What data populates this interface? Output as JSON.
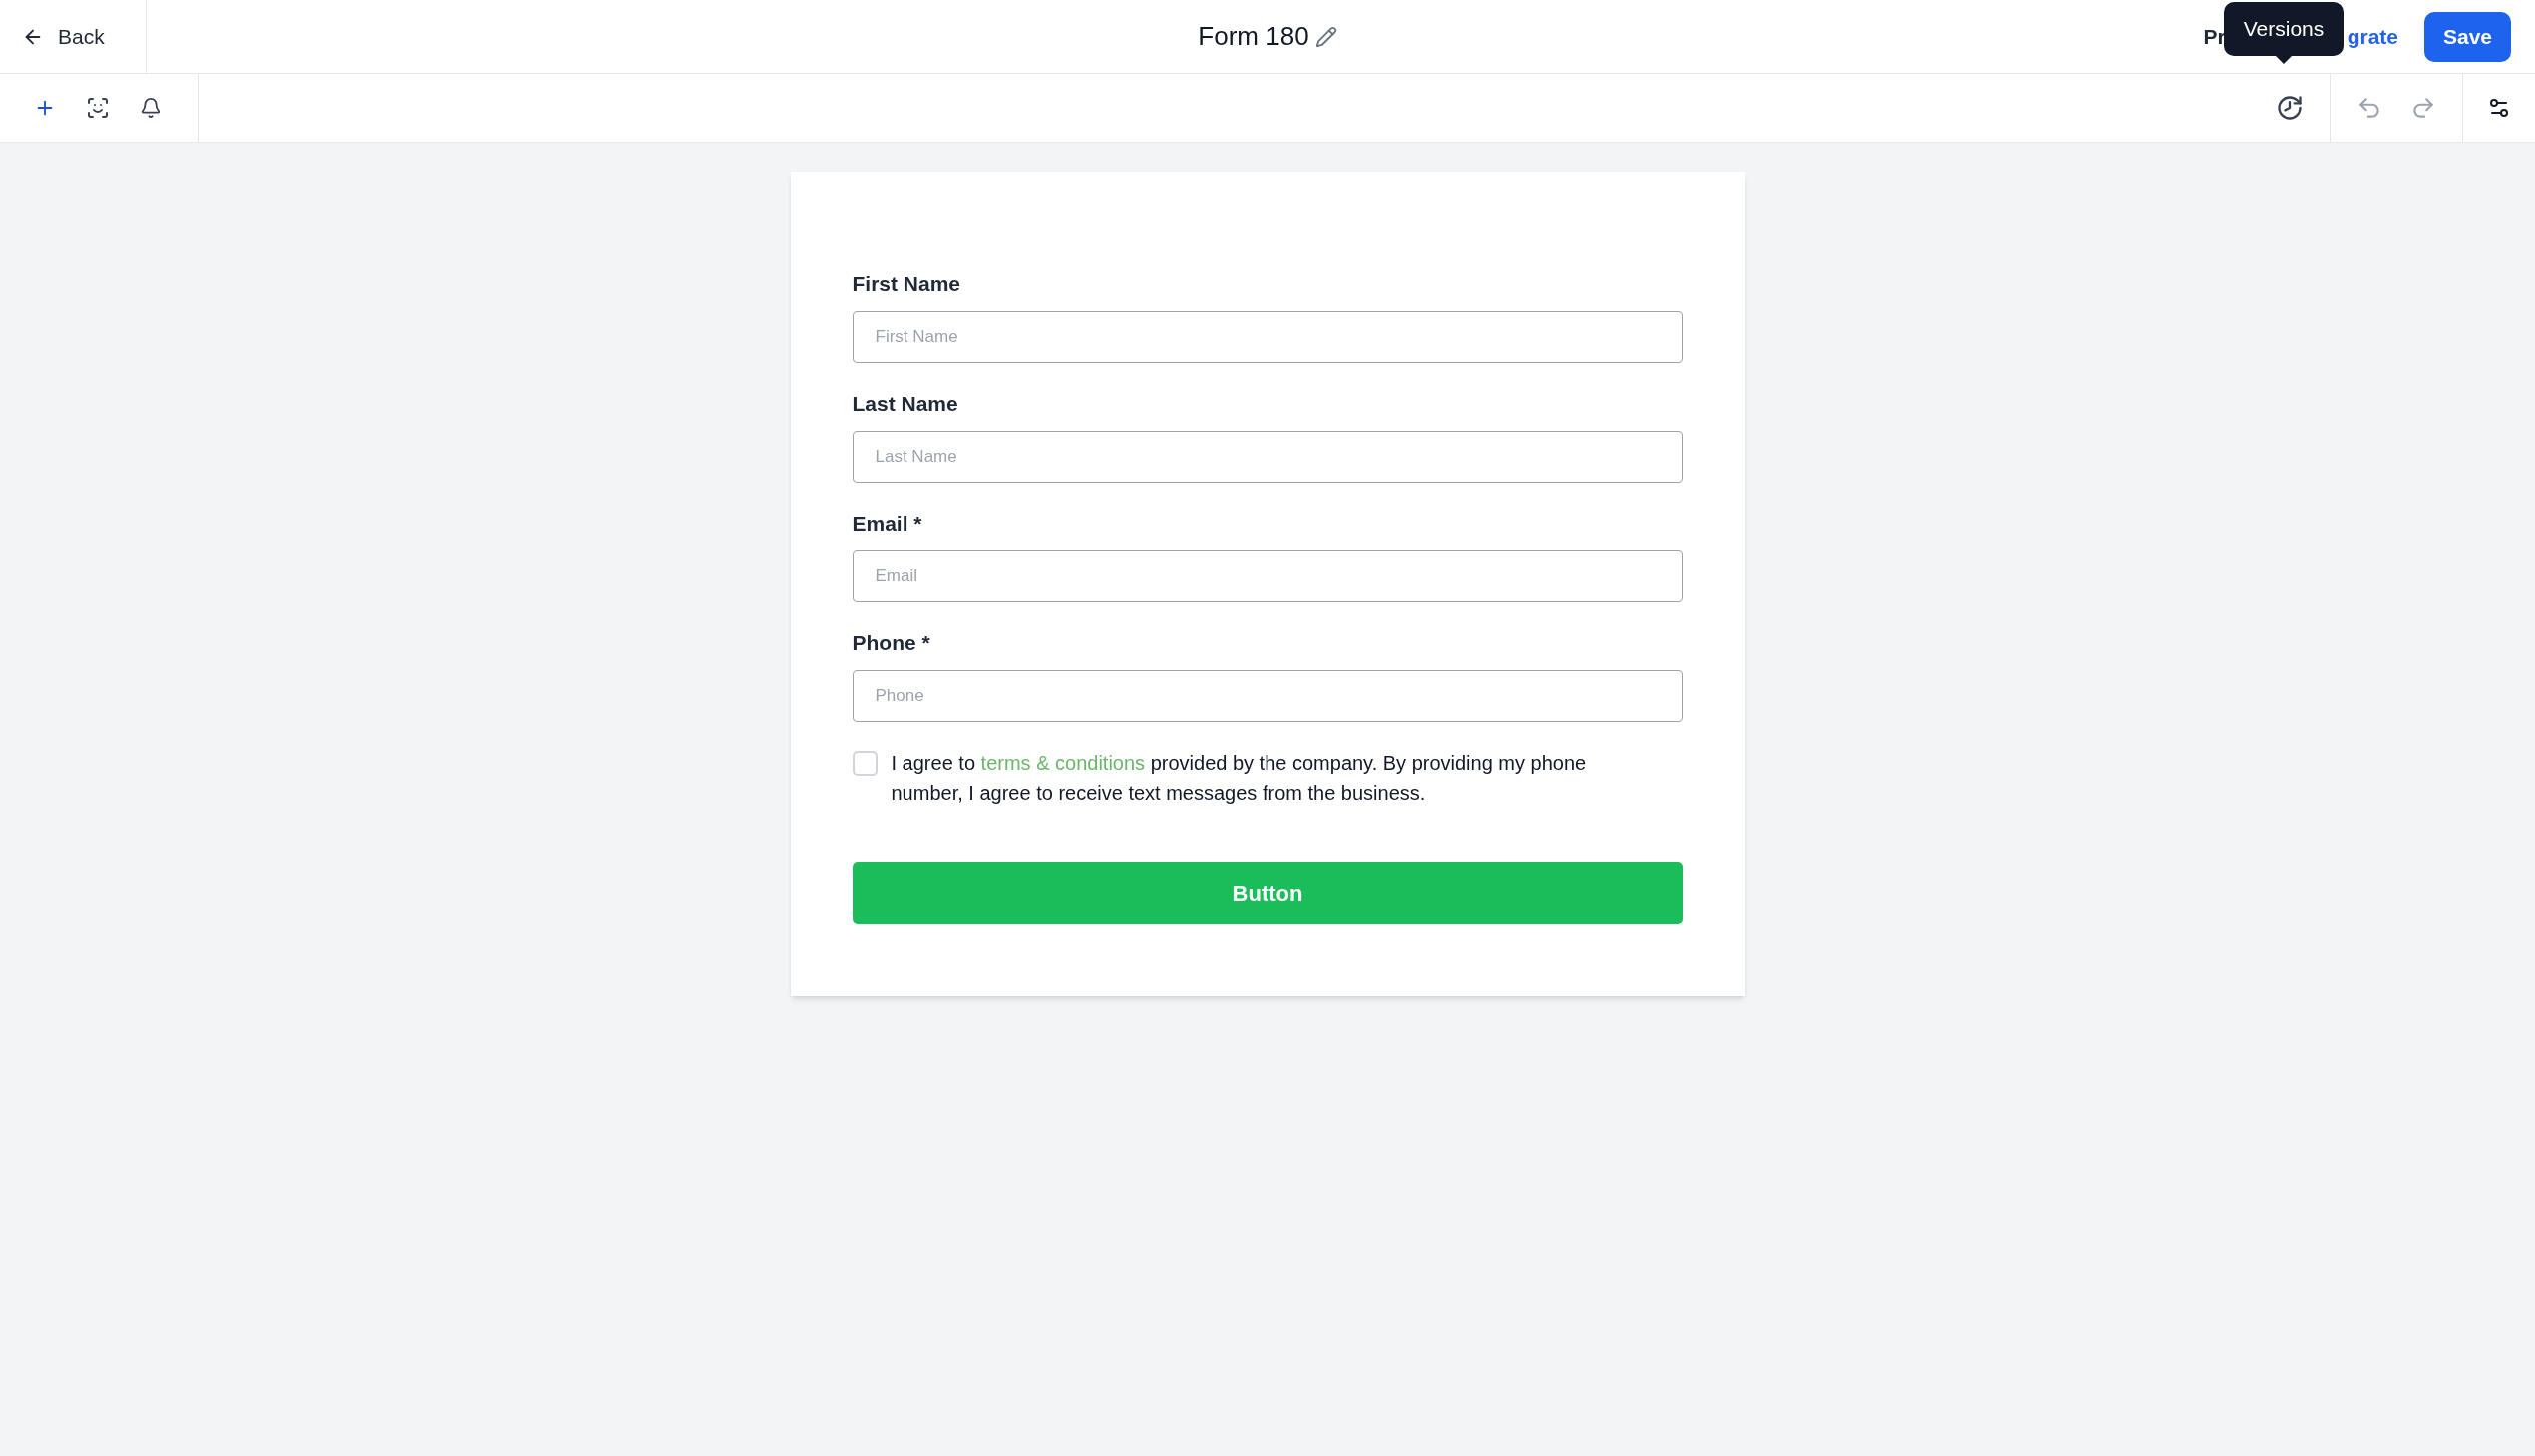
{
  "header": {
    "back": "Back",
    "title": "Form 180",
    "preview_partial": "Pr",
    "integrate_partial": "grate",
    "save": "Save",
    "tooltip": "Versions"
  },
  "fields": [
    {
      "label": "First Name",
      "placeholder": "First Name"
    },
    {
      "label": "Last Name",
      "placeholder": "Last Name"
    },
    {
      "label": "Email *",
      "placeholder": "Email"
    },
    {
      "label": "Phone *",
      "placeholder": "Phone"
    }
  ],
  "consent": {
    "checked": false,
    "before": "I agree to",
    "link": "terms & conditions",
    "after": "provided by the company. By providing my phone number, I agree to receive text messages from the business."
  },
  "submit": "Button"
}
